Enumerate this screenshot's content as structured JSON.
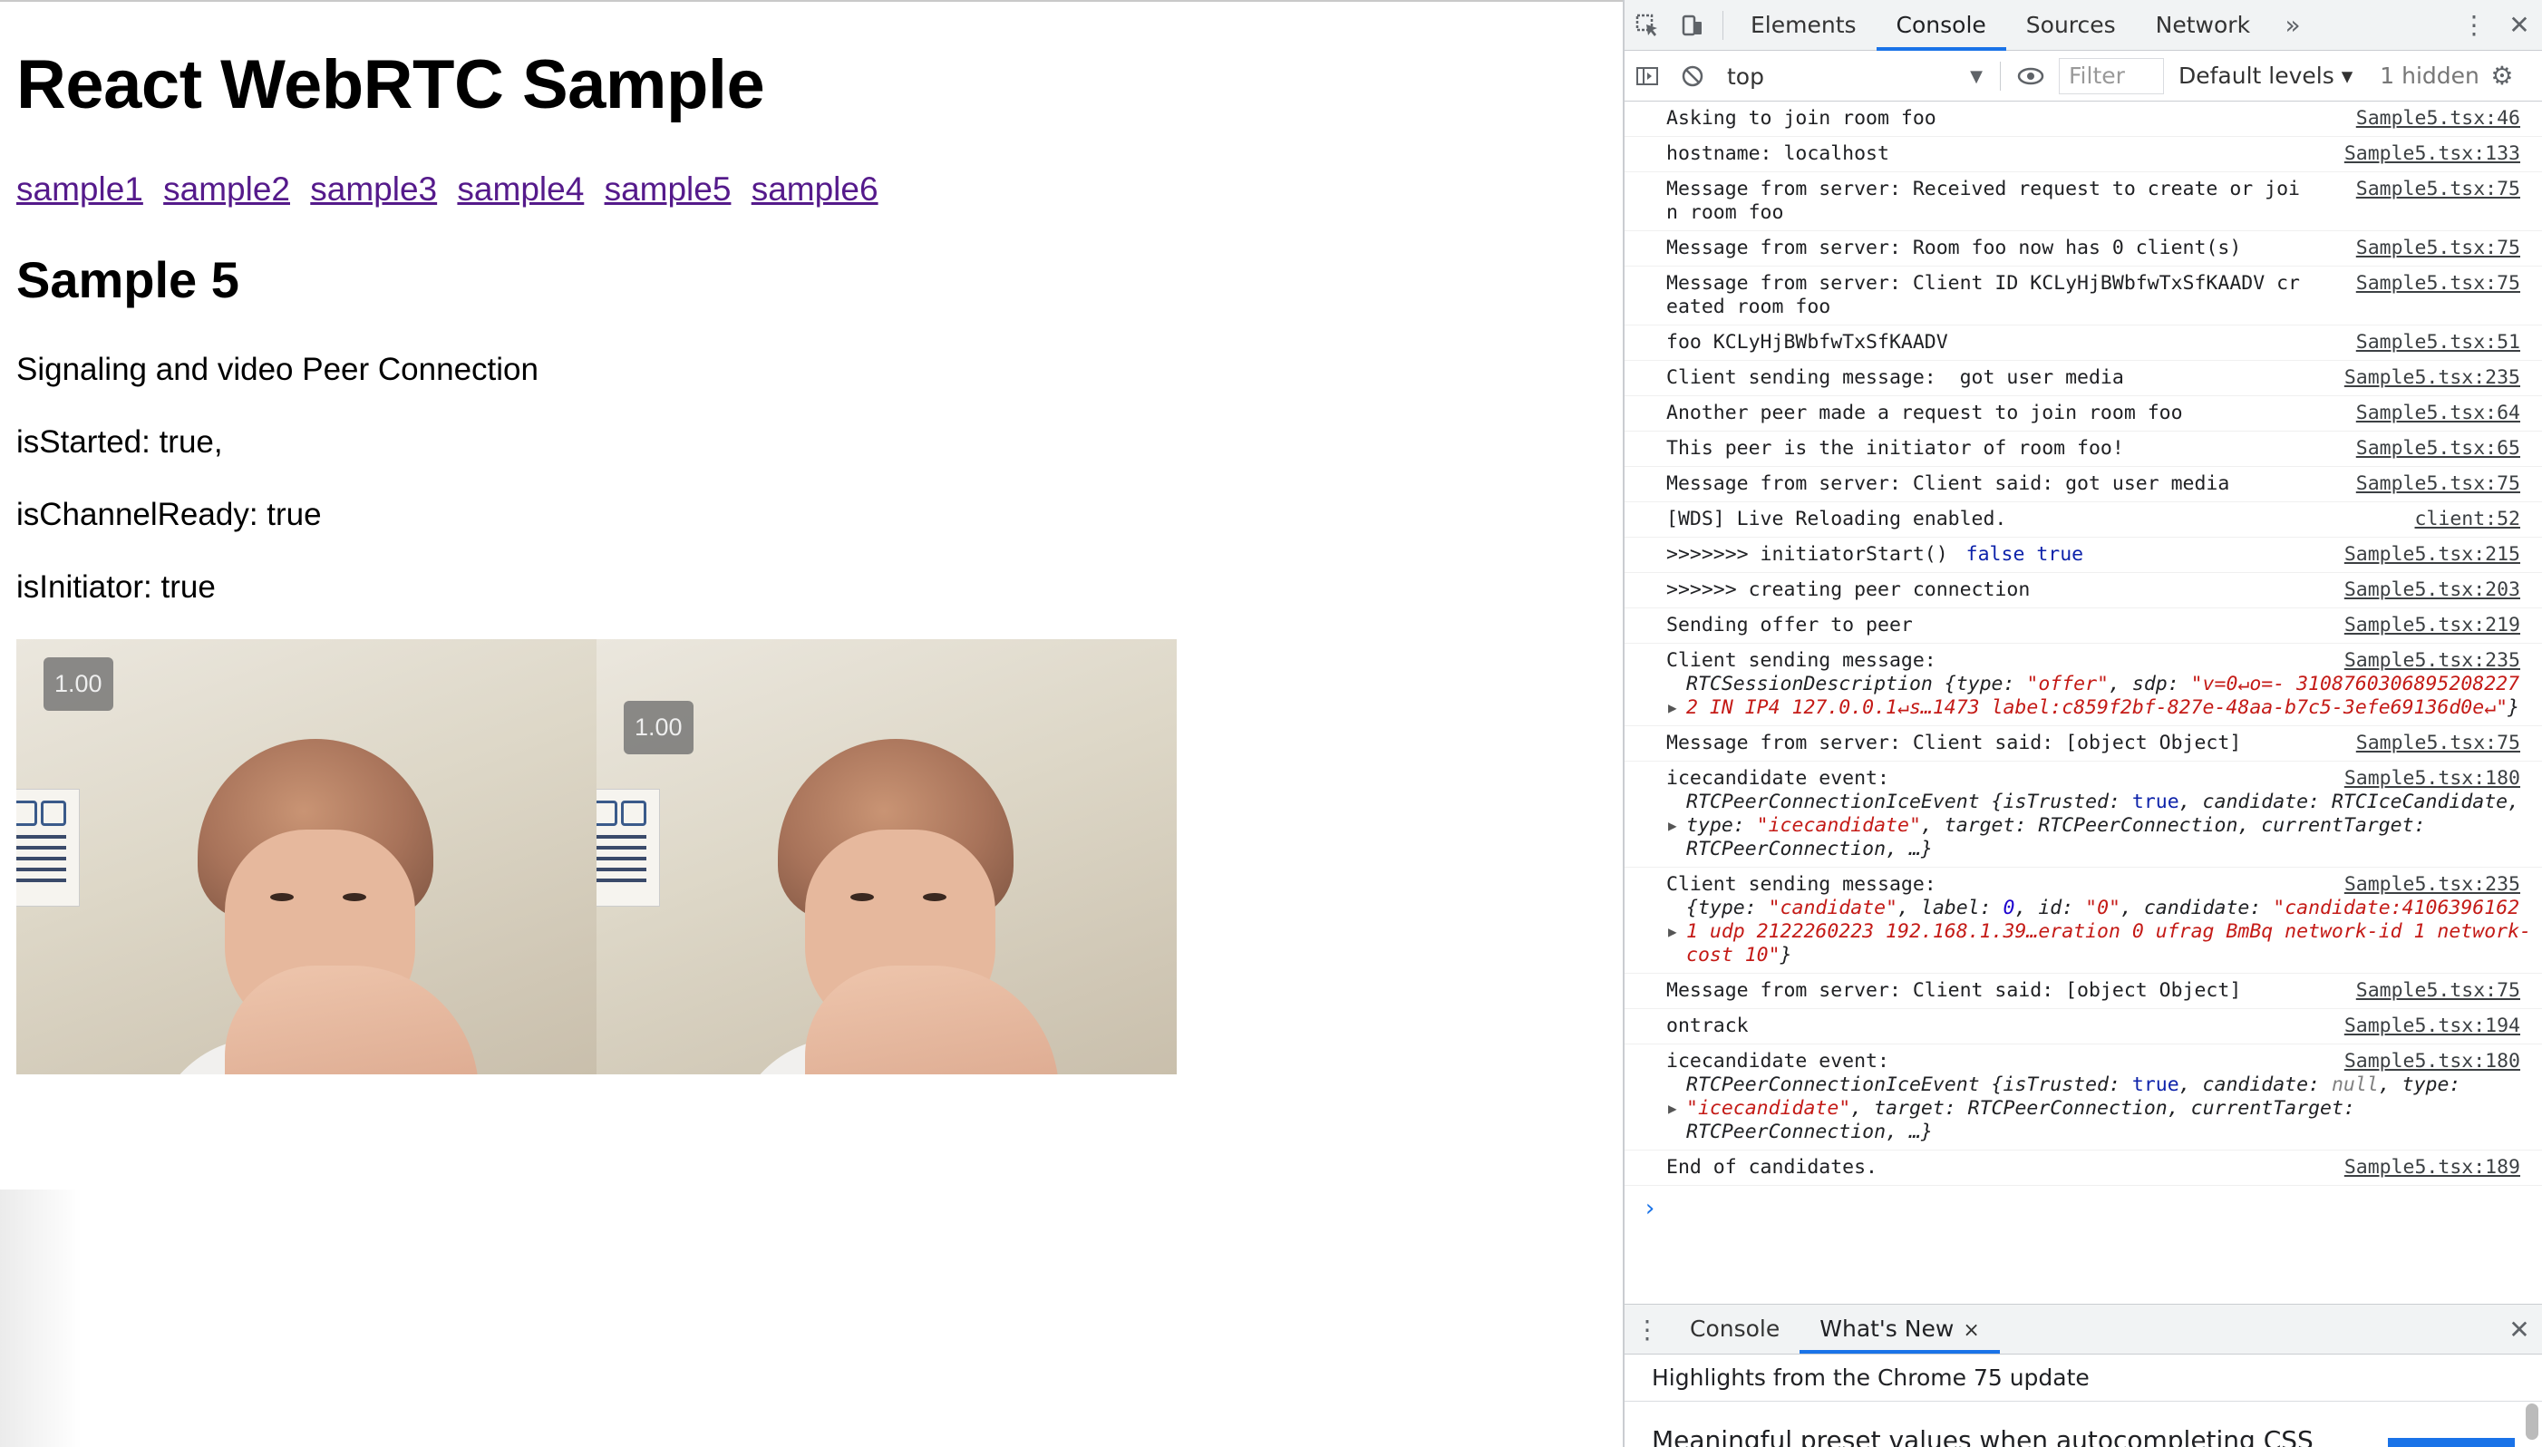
{
  "page": {
    "title": "React WebRTC Sample",
    "links": [
      "sample1",
      "sample2",
      "sample3",
      "sample4",
      "sample5",
      "sample6"
    ],
    "heading": "Sample 5",
    "description": "Signaling and video Peer Connection",
    "is_started": "isStarted: true,",
    "is_channel_ready": "isChannelReady: true",
    "is_initiator": "isInitiator: true",
    "videos": [
      {
        "zoom": "1.00"
      },
      {
        "zoom": "1.00"
      }
    ]
  },
  "devtools": {
    "tabs": [
      "Elements",
      "Console",
      "Sources",
      "Network"
    ],
    "active_tab": "Console",
    "more_tabs_icon": "chevron-double-right-icon",
    "context": "top",
    "filter_placeholder": "Filter",
    "levels": "Default levels",
    "hidden": "1 hidden",
    "messages": [
      {
        "text": "Asking to join room foo",
        "src": "Sample5.tsx:46"
      },
      {
        "text": "hostname: localhost",
        "src": "Sample5.tsx:133"
      },
      {
        "text": "Message from server: Received request to create or join room foo",
        "src": "Sample5.tsx:75"
      },
      {
        "text": "Message from server: Room foo now has 0 client(s)",
        "src": "Sample5.tsx:75"
      },
      {
        "text": "Message from server: Client ID KCLyHjBWbfwTxSfKAADV created room foo",
        "src": "Sample5.tsx:75"
      },
      {
        "text": "foo KCLyHjBWbfwTxSfKAADV",
        "src": "Sample5.tsx:51"
      },
      {
        "text": "Client sending message:  got user media",
        "src": "Sample5.tsx:235"
      },
      {
        "text": "Another peer made a request to join room foo",
        "src": "Sample5.tsx:64"
      },
      {
        "text": "This peer is the initiator of room foo!",
        "src": "Sample5.tsx:65"
      },
      {
        "text": "Message from server: Client said: got user media",
        "src": "Sample5.tsx:75"
      },
      {
        "text": "[WDS] Live Reloading enabled.",
        "src": "client:52"
      },
      {
        "text": ">>>>>>> initiatorStart()",
        "extra": "false true",
        "src": "Sample5.tsx:215"
      },
      {
        "text": ">>>>>> creating peer connection",
        "src": "Sample5.tsx:203"
      },
      {
        "text": "Sending offer to peer",
        "src": "Sample5.tsx:219"
      }
    ],
    "msg_offer": {
      "label": "Client sending message:",
      "src": "Sample5.tsx:235",
      "class_name": "RTCSessionDescription",
      "type_value": "\"offer\"",
      "sdp_value": "\"v=0↵o=- 3108760306895208227 2 IN IP4 127.0.0.1↵s…1473 label:c859f2bf-827e-48aa-b7c5-3efe69136d0e↵\""
    },
    "msg_obj1": {
      "text": "Message from server: Client said: [object Object]",
      "src": "Sample5.tsx:75"
    },
    "msg_ice1": {
      "label": "icecandidate event:",
      "src": "Sample5.tsx:180",
      "class_name": "RTCPeerConnectionIceEvent",
      "is_trusted": "true",
      "candidate": "RTCIceCandidate",
      "type_value": "\"icecandidate\"",
      "target": "RTCPeerConnection",
      "current_target": "RTCPeerConnection"
    },
    "msg_cand": {
      "label": "Client sending message:",
      "src": "Sample5.tsx:235",
      "type_value": "\"candidate\"",
      "label_value": "0",
      "id_value": "\"0\"",
      "candidate_value": "\"candidate:4106396162 1 udp 2122260223 192.168.1.39…eration 0 ufrag BmBq network-id 1 network-cost 10\""
    },
    "msg_obj2": {
      "text": "Message from server: Client said: [object Object]",
      "src": "Sample5.tsx:75"
    },
    "msg_ontrack": {
      "text": "ontrack",
      "src": "Sample5.tsx:194"
    },
    "msg_ice2": {
      "label": "icecandidate event:",
      "src": "Sample5.tsx:180",
      "class_name": "RTCPeerConnectionIceEvent",
      "is_trusted": "true",
      "candidate": "null",
      "type_value": "\"icecandidate\"",
      "target": "RTCPeerConnection",
      "current_target": "RTCPeerConnection"
    },
    "msg_end": {
      "text": "End of candidates.",
      "src": "Sample5.tsx:189"
    },
    "prompt": "›",
    "drawer_tabs": [
      "Console",
      "What's New"
    ],
    "drawer_close": "×",
    "whats_new_title": "Highlights from the Chrome 75 update",
    "whats_new_item": "Meaningful preset values when autocompleting CSS"
  }
}
